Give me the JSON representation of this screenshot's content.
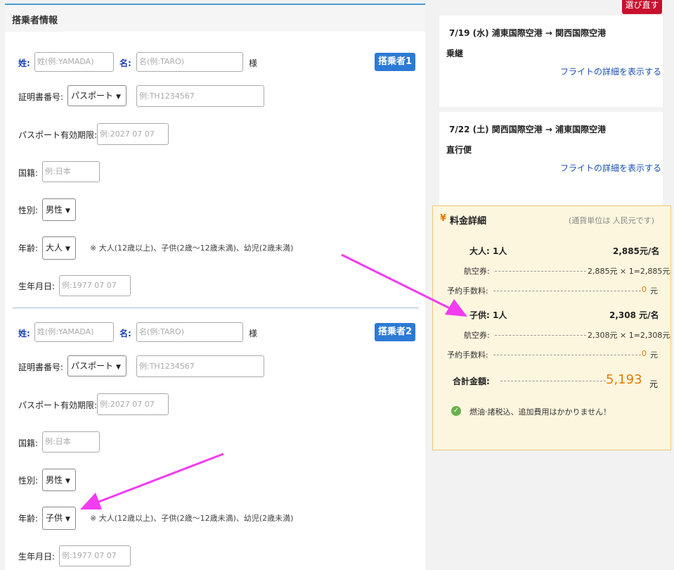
{
  "form": {
    "title": "搭乗者情報",
    "passengers": [
      {
        "badge": "搭乗者1",
        "last_label": "姓:",
        "last_placeholder": "姓(例:YAMADA)",
        "first_label": "名:",
        "first_placeholder": "名(例:TARO)",
        "honorific": "様",
        "id_label": "証明書番号:",
        "id_type": "パスポート",
        "id_placeholder": "例:TH1234567",
        "expiry_label": "パスポート有効期限:",
        "expiry_placeholder": "例:2027 07 07",
        "nationality_label": "国籍:",
        "nationality_placeholder": "例:日本",
        "gender_label": "性別:",
        "gender_value": "男性",
        "age_label": "年齢:",
        "age_value": "大人",
        "age_note": "※ 大人(12歳以上)、子供(2歳～12歳未満)、幼児(2歳未満)",
        "birth_label": "生年月日:",
        "birth_placeholder": "例:1977 07 07"
      },
      {
        "badge": "搭乗者2",
        "last_label": "姓:",
        "last_placeholder": "姓(例:YAMADA)",
        "first_label": "名:",
        "first_placeholder": "名(例:TARO)",
        "honorific": "様",
        "id_label": "証明書番号:",
        "id_type": "パスポート",
        "id_placeholder": "例:TH1234567",
        "expiry_label": "パスポート有効期限:",
        "expiry_placeholder": "例:2027 07 07",
        "nationality_label": "国籍:",
        "nationality_placeholder": "例:日本",
        "gender_label": "性別:",
        "gender_value": "男性",
        "age_label": "年齢:",
        "age_value": "子供",
        "age_note": "※ 大人(12歳以上)、子供(2歳～12歳未満)、幼児(2歳未満)",
        "birth_label": "生年月日:",
        "birth_placeholder": "例:1977 07 07"
      }
    ]
  },
  "reselect_label": "選び直す",
  "flights": [
    {
      "route": "7/19 (水) 浦東国際空港 → 関西国際空港",
      "type": "乗継",
      "link": "フライトの詳細を表示する"
    },
    {
      "route": "7/22 (土) 関西国際空港 → 浦東国際空港",
      "type": "直行便",
      "link": "フライトの詳細を表示する"
    }
  ],
  "price": {
    "currency_symbol": "¥",
    "title": "料金詳細",
    "currency_note": "(通貨単位は 人民元です)",
    "adult": {
      "label": "大人: 1人",
      "amount": "2,885元/名",
      "fare_label": "航空券:",
      "fare_calc": "2,885元 × 1=2,885元",
      "fee_label": "予約手数料:",
      "fee_value": "0",
      "fee_unit": "元"
    },
    "child": {
      "label": "子供: 1人",
      "amount": "2,308 元/名",
      "fare_label": "航空券:",
      "fare_calc": "2,308元 × 1=2,308元",
      "fee_label": "予約手数料:",
      "fee_value": "0",
      "fee_unit": "元"
    },
    "total_label": "合計金額:",
    "total_value": "5,193",
    "total_unit": "元",
    "included_note": "燃油·諸税込、追加費用はかかりません！"
  },
  "colors": {
    "accent_blue": "#2c7ad6",
    "arrow_magenta": "#f23cf0",
    "total_orange": "#e87a00",
    "check_green": "#6ab04c"
  }
}
